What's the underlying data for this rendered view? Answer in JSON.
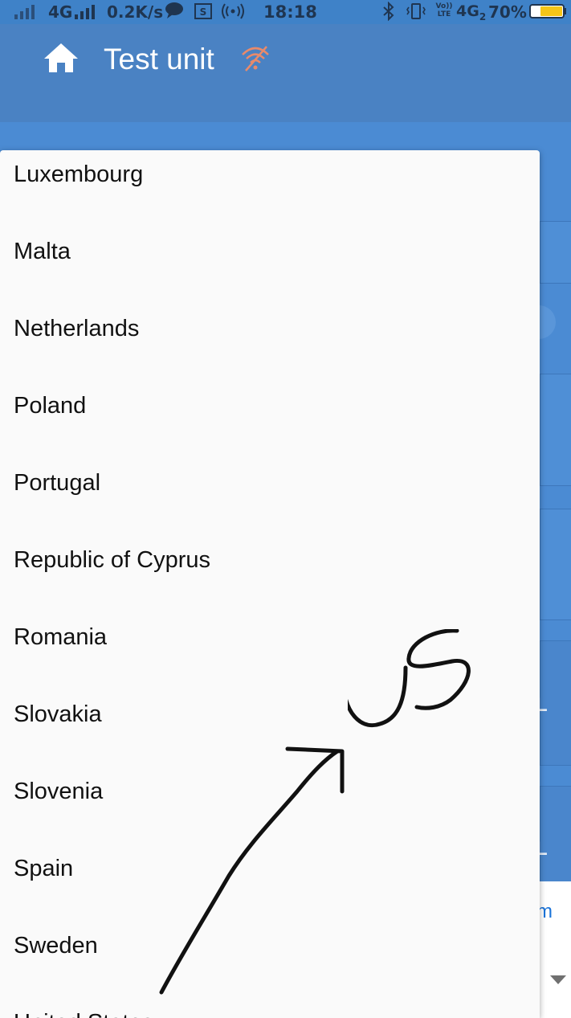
{
  "status_bar": {
    "network_type": "4G",
    "speed": "0.2K/s",
    "time": "18:18",
    "volte_label": "Vo)) LTE",
    "network_type_2": "4G",
    "sim_slot": "2",
    "battery_percent": "70%",
    "icons": [
      "signal-icon",
      "signal-icon",
      "chat-icon",
      "screenshot-icon",
      "radio-icon",
      "bluetooth-icon",
      "vibrate-icon",
      "battery-icon"
    ]
  },
  "app_bar": {
    "title": "Test unit",
    "icons": [
      "home-icon",
      "wifi-off-icon"
    ],
    "wifi_off_color": "#e88a6b"
  },
  "background": {
    "letter_1": "L",
    "letter_2": "L",
    "link_text": "rm",
    "link_color": "#1a73d9"
  },
  "dropdown": {
    "options": [
      "Luxembourg",
      "Malta",
      "Netherlands",
      "Poland",
      "Portugal",
      "Republic of Cyprus",
      "Romania",
      "Slovakia",
      "Slovenia",
      "Spain",
      "Sweden",
      "United States"
    ]
  },
  "annotation": {
    "handwritten_text": "US",
    "icon": "arrow-icon"
  },
  "colors": {
    "app_bar": "#4a82c3",
    "status_bar": "#3f82c8",
    "dropdown_bg": "#fafafa"
  }
}
